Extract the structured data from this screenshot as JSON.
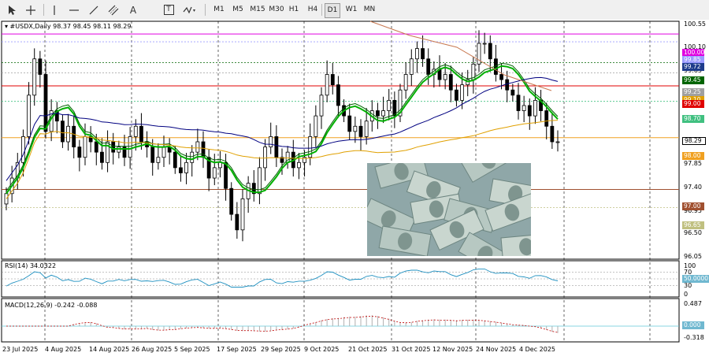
{
  "toolbar": {
    "tools": [
      "cursor-icon",
      "crosshair-icon",
      "vertical-line-icon",
      "horizontal-line-icon",
      "trendline-icon",
      "channel-icon",
      "text-icon",
      "label-icon",
      "shapes-icon"
    ],
    "text_tool": "A",
    "label_tool": "T",
    "timeframes": [
      "M1",
      "M5",
      "M15",
      "M30",
      "H1",
      "H4",
      "D1",
      "W1",
      "MN"
    ],
    "active_timeframe": "D1"
  },
  "main_chart": {
    "title": "▾ #USDX,Daily  98.37 98.45 98.11 98.29",
    "y_ticks": [
      "100.55",
      "100.10",
      "99.65",
      "99.25",
      "98.80",
      "98.35",
      "97.85",
      "97.40",
      "96.95",
      "96.50",
      "96.05"
    ],
    "price_tags": [
      {
        "text": "100.00",
        "color": "#e000e0"
      },
      {
        "text": "99.85",
        "color": "#9c9cff"
      },
      {
        "text": "99.72",
        "color": "#1e3c8c"
      },
      {
        "text": "99.45",
        "color": "#006400"
      },
      {
        "text": "99.25",
        "color": "#a0a0a0"
      },
      {
        "text": "99.10",
        "color": "#e0a000"
      },
      {
        "text": "99.00",
        "color": "#e00000"
      },
      {
        "text": "98.70",
        "color": "#40c080"
      },
      {
        "text": "98.29",
        "color": "#000000"
      },
      {
        "text": "98.00",
        "color": "#f0a020"
      },
      {
        "text": "97.00",
        "color": "#a05030"
      },
      {
        "text": "96.65",
        "color": "#c0c080"
      }
    ]
  },
  "rsi_panel": {
    "title": "RSI(14) 34.0322",
    "ticks": [
      "100",
      "70",
      "30",
      "0"
    ],
    "tag": "50.0000"
  },
  "macd_panel": {
    "title": "MACD(12,26,9) -0.242 -0.088",
    "ticks": [
      "0.487",
      "-0.318"
    ],
    "tag": "0.000"
  },
  "x_axis": [
    "23 Jul 2025",
    "4 Aug 2025",
    "14 Aug 2025",
    "26 Aug 2025",
    "5 Sep 2025",
    "17 Sep 2025",
    "29 Sep 2025",
    "9 Oct 2025",
    "21 Oct 2025",
    "31 Oct 2025",
    "12 Nov 2025",
    "24 Nov 2025",
    "4 Dec 2025"
  ],
  "colors": {
    "ma_slow": "#000080",
    "ma_fast": "#008000",
    "ma_orange": "#e0a000",
    "ma_brown": "#c87850"
  }
}
